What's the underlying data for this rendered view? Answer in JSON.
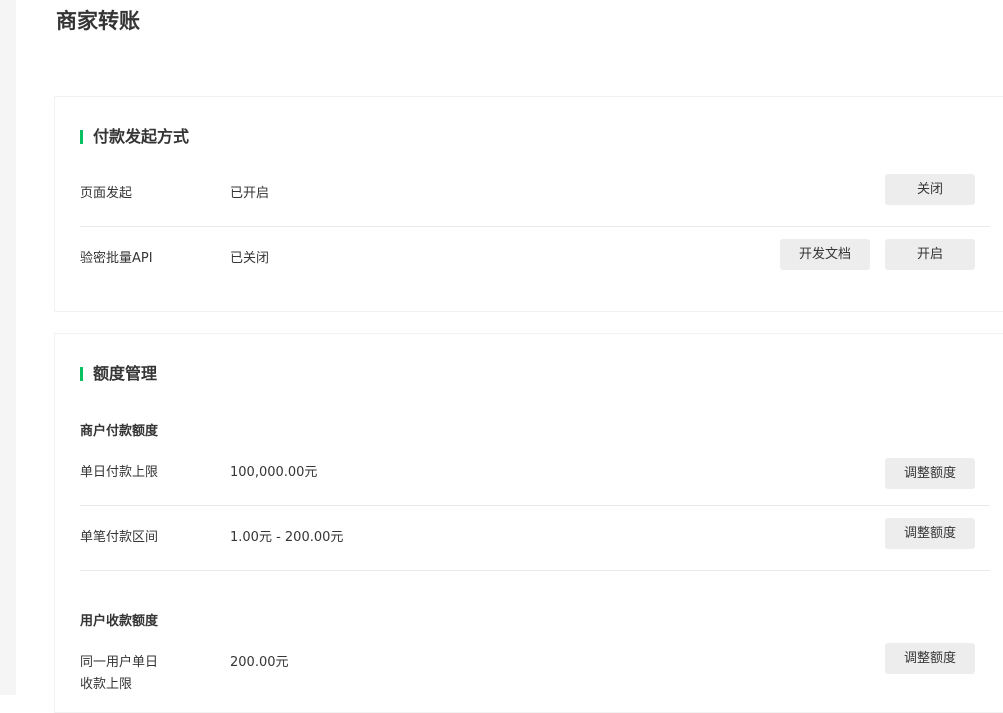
{
  "page": {
    "title": "商家转账"
  },
  "payment_method": {
    "title": "付款发起方式",
    "rows": [
      {
        "label": "页面发起",
        "status": "已开启",
        "action_label": "关闭"
      },
      {
        "label": "验密批量API",
        "status": "已关闭",
        "docs_label": "开发文档",
        "action_label": "开启"
      }
    ]
  },
  "quota": {
    "title": "额度管理",
    "merchant": {
      "title": "商户付款额度",
      "rows": [
        {
          "label": "单日付款上限",
          "value": "100,000.00元",
          "action_label": "调整额度"
        },
        {
          "label": "单笔付款区间",
          "value": "1.00元 - 200.00元",
          "action_label": "调整额度"
        }
      ]
    },
    "user": {
      "title": "用户收款额度",
      "rows": [
        {
          "label_line1": "同一用户单日",
          "label_line2": "收款上限",
          "value": "200.00元",
          "action_label": "调整额度"
        }
      ]
    }
  },
  "colors": {
    "accent": "#07c160",
    "button_bg": "#ededed",
    "text": "#353535"
  }
}
